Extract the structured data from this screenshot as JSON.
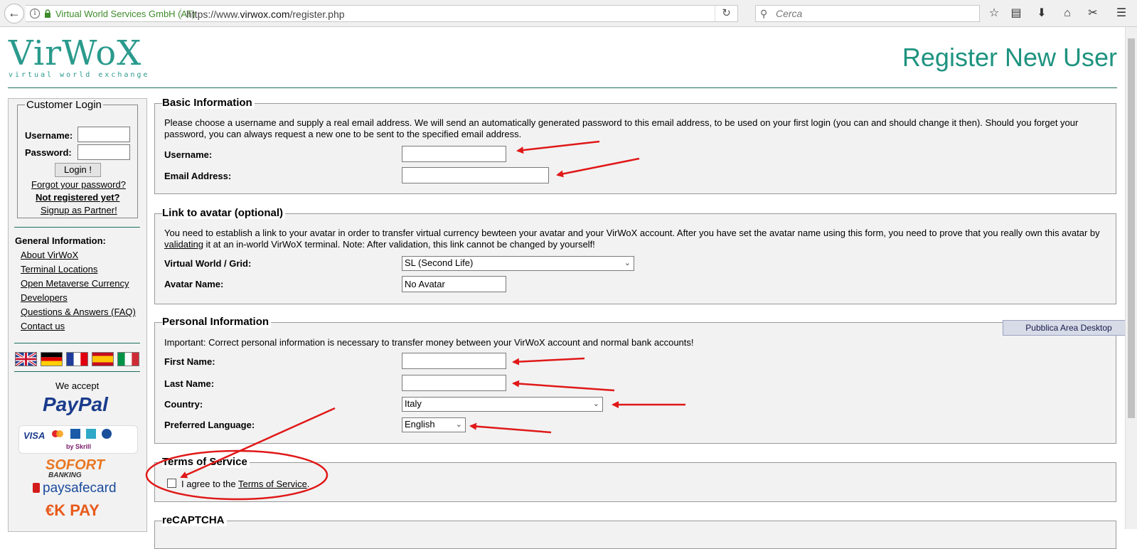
{
  "browser": {
    "site_identity": "Virtual World Services GmbH (AT)",
    "url_prefix": "https://www.",
    "url_domain": "virwox.com",
    "url_path": "/register.php",
    "search_placeholder": "Cerca"
  },
  "header": {
    "logo_text": "VirWoX",
    "logo_tagline": "virtual world exchange",
    "page_title": "Register New User"
  },
  "sidebar": {
    "login": {
      "legend": "Customer Login",
      "username_label": "Username:",
      "password_label": "Password:",
      "login_button": "Login !",
      "forgot_link": "Forgot your password?",
      "not_registered": "Not registered yet?",
      "partner_link": "Signup as Partner!"
    },
    "general_heading": "General Information:",
    "links": [
      "About VirWoX",
      "Terminal Locations",
      "Open Metaverse Currency",
      "Developers",
      "Questions & Answers (FAQ)",
      "Contact us"
    ],
    "flags": [
      "uk-flag",
      "germany-flag",
      "france-flag",
      "spain-flag",
      "italy-flag"
    ],
    "we_accept": "We accept",
    "payment": {
      "paypal": "PayPal",
      "skrill_by": "by Skrill",
      "card_visa": "VISA",
      "sofort": "SOFORT",
      "sofort_sub": "BANKING",
      "paysafe": "paysafecard",
      "okpay": "€K PAY"
    }
  },
  "basic": {
    "legend": "Basic Information",
    "text": "Please choose a username and supply a real email address. We will send an automatically generated password to this email address, to be used on your first login (you can and should change it then). Should you forget your password, you can always request a new one to be sent to the specified email address.",
    "username_label": "Username:",
    "email_label": "Email Address:"
  },
  "avatar": {
    "legend": "Link to avatar (optional)",
    "text_1": "You need to establish a link to your avatar in order to transfer virtual currency bewteen your avatar and your VirWoX account. After you have set the avatar name using this form, you need to prove that you really own this avatar by",
    "text_link": "validating",
    "text_2": " it at an in-world VirWoX terminal. Note: After validation, this link cannot be changed by yourself!",
    "grid_label": "Virtual World / Grid:",
    "grid_value": "SL (Second Life)",
    "avatar_label": "Avatar Name:",
    "avatar_value": "No Avatar"
  },
  "personal": {
    "legend": "Personal Information",
    "text": "Important: Correct personal information is necessary to transfer money between your VirWoX account and normal bank accounts!",
    "first_label": "First Name:",
    "last_label": "Last Name:",
    "country_label": "Country:",
    "country_value": "Italy",
    "lang_label": "Preferred Language:",
    "lang_value": "English"
  },
  "tos": {
    "legend": "Terms of Service",
    "agree_text": "I agree to the ",
    "tos_link": "Terms of Service",
    "period": "."
  },
  "recaptcha": {
    "legend": "reCAPTCHA"
  },
  "tooltip": "Pubblica Area Desktop",
  "colors": {
    "brand": "#1e9380",
    "annotation": "#e01818"
  }
}
